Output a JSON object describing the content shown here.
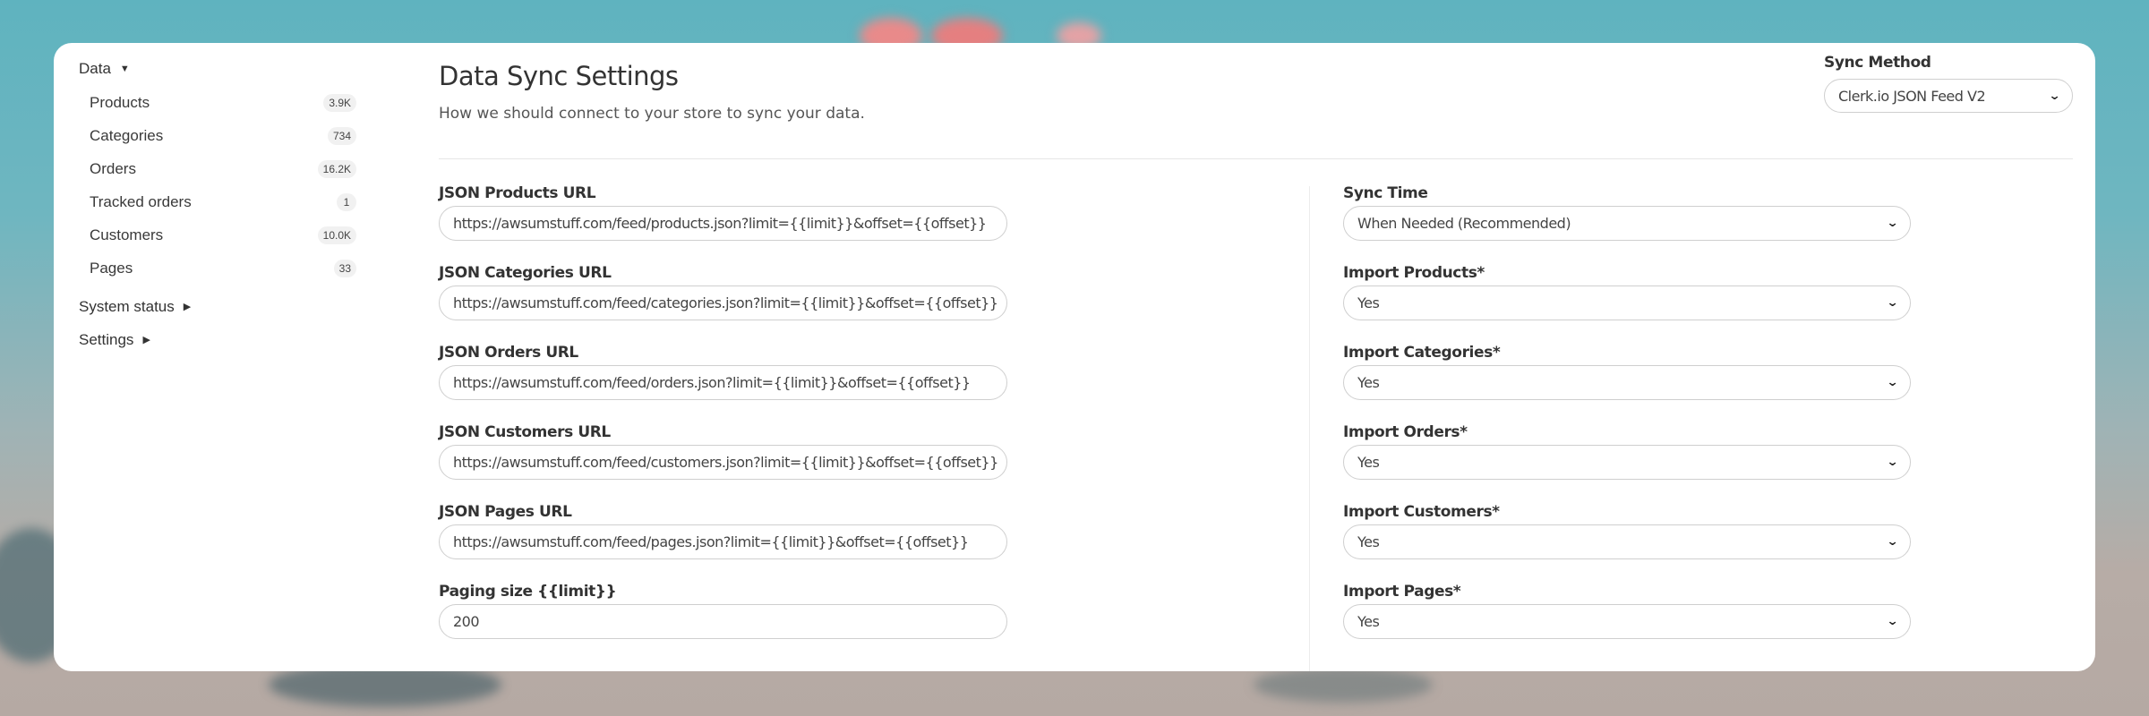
{
  "sidebar": {
    "data_group": "Data",
    "items": [
      {
        "label": "Products",
        "count": "3.9K"
      },
      {
        "label": "Categories",
        "count": "734"
      },
      {
        "label": "Orders",
        "count": "16.2K"
      },
      {
        "label": "Tracked orders",
        "count": "1"
      },
      {
        "label": "Customers",
        "count": "10.0K"
      },
      {
        "label": "Pages",
        "count": "33"
      }
    ],
    "system_status": "System status",
    "settings": "Settings"
  },
  "header": {
    "title": "Data Sync Settings",
    "subtitle": "How we should connect to your store to sync your data."
  },
  "sync_method": {
    "label": "Sync Method",
    "value": "Clerk.io JSON Feed V2"
  },
  "left_fields": [
    {
      "label": "JSON Products URL",
      "value": "https://awsumstuff.com/feed/products.json?limit={{limit}}&offset={{offset}}"
    },
    {
      "label": "JSON Categories URL",
      "value": "https://awsumstuff.com/feed/categories.json?limit={{limit}}&offset={{offset}}"
    },
    {
      "label": "JSON Orders URL",
      "value": "https://awsumstuff.com/feed/orders.json?limit={{limit}}&offset={{offset}}"
    },
    {
      "label": "JSON Customers URL",
      "value": "https://awsumstuff.com/feed/customers.json?limit={{limit}}&offset={{offset}}"
    },
    {
      "label": "JSON Pages URL",
      "value": "https://awsumstuff.com/feed/pages.json?limit={{limit}}&offset={{offset}}"
    },
    {
      "label": "Paging size {{limit}}",
      "value": "200"
    }
  ],
  "right_fields": [
    {
      "label": "Sync Time",
      "value": "When Needed (Recommended)"
    },
    {
      "label": "Import Products*",
      "value": "Yes"
    },
    {
      "label": "Import Categories*",
      "value": "Yes"
    },
    {
      "label": "Import Orders*",
      "value": "Yes"
    },
    {
      "label": "Import Customers*",
      "value": "Yes"
    },
    {
      "label": "Import Pages*",
      "value": "Yes"
    }
  ]
}
